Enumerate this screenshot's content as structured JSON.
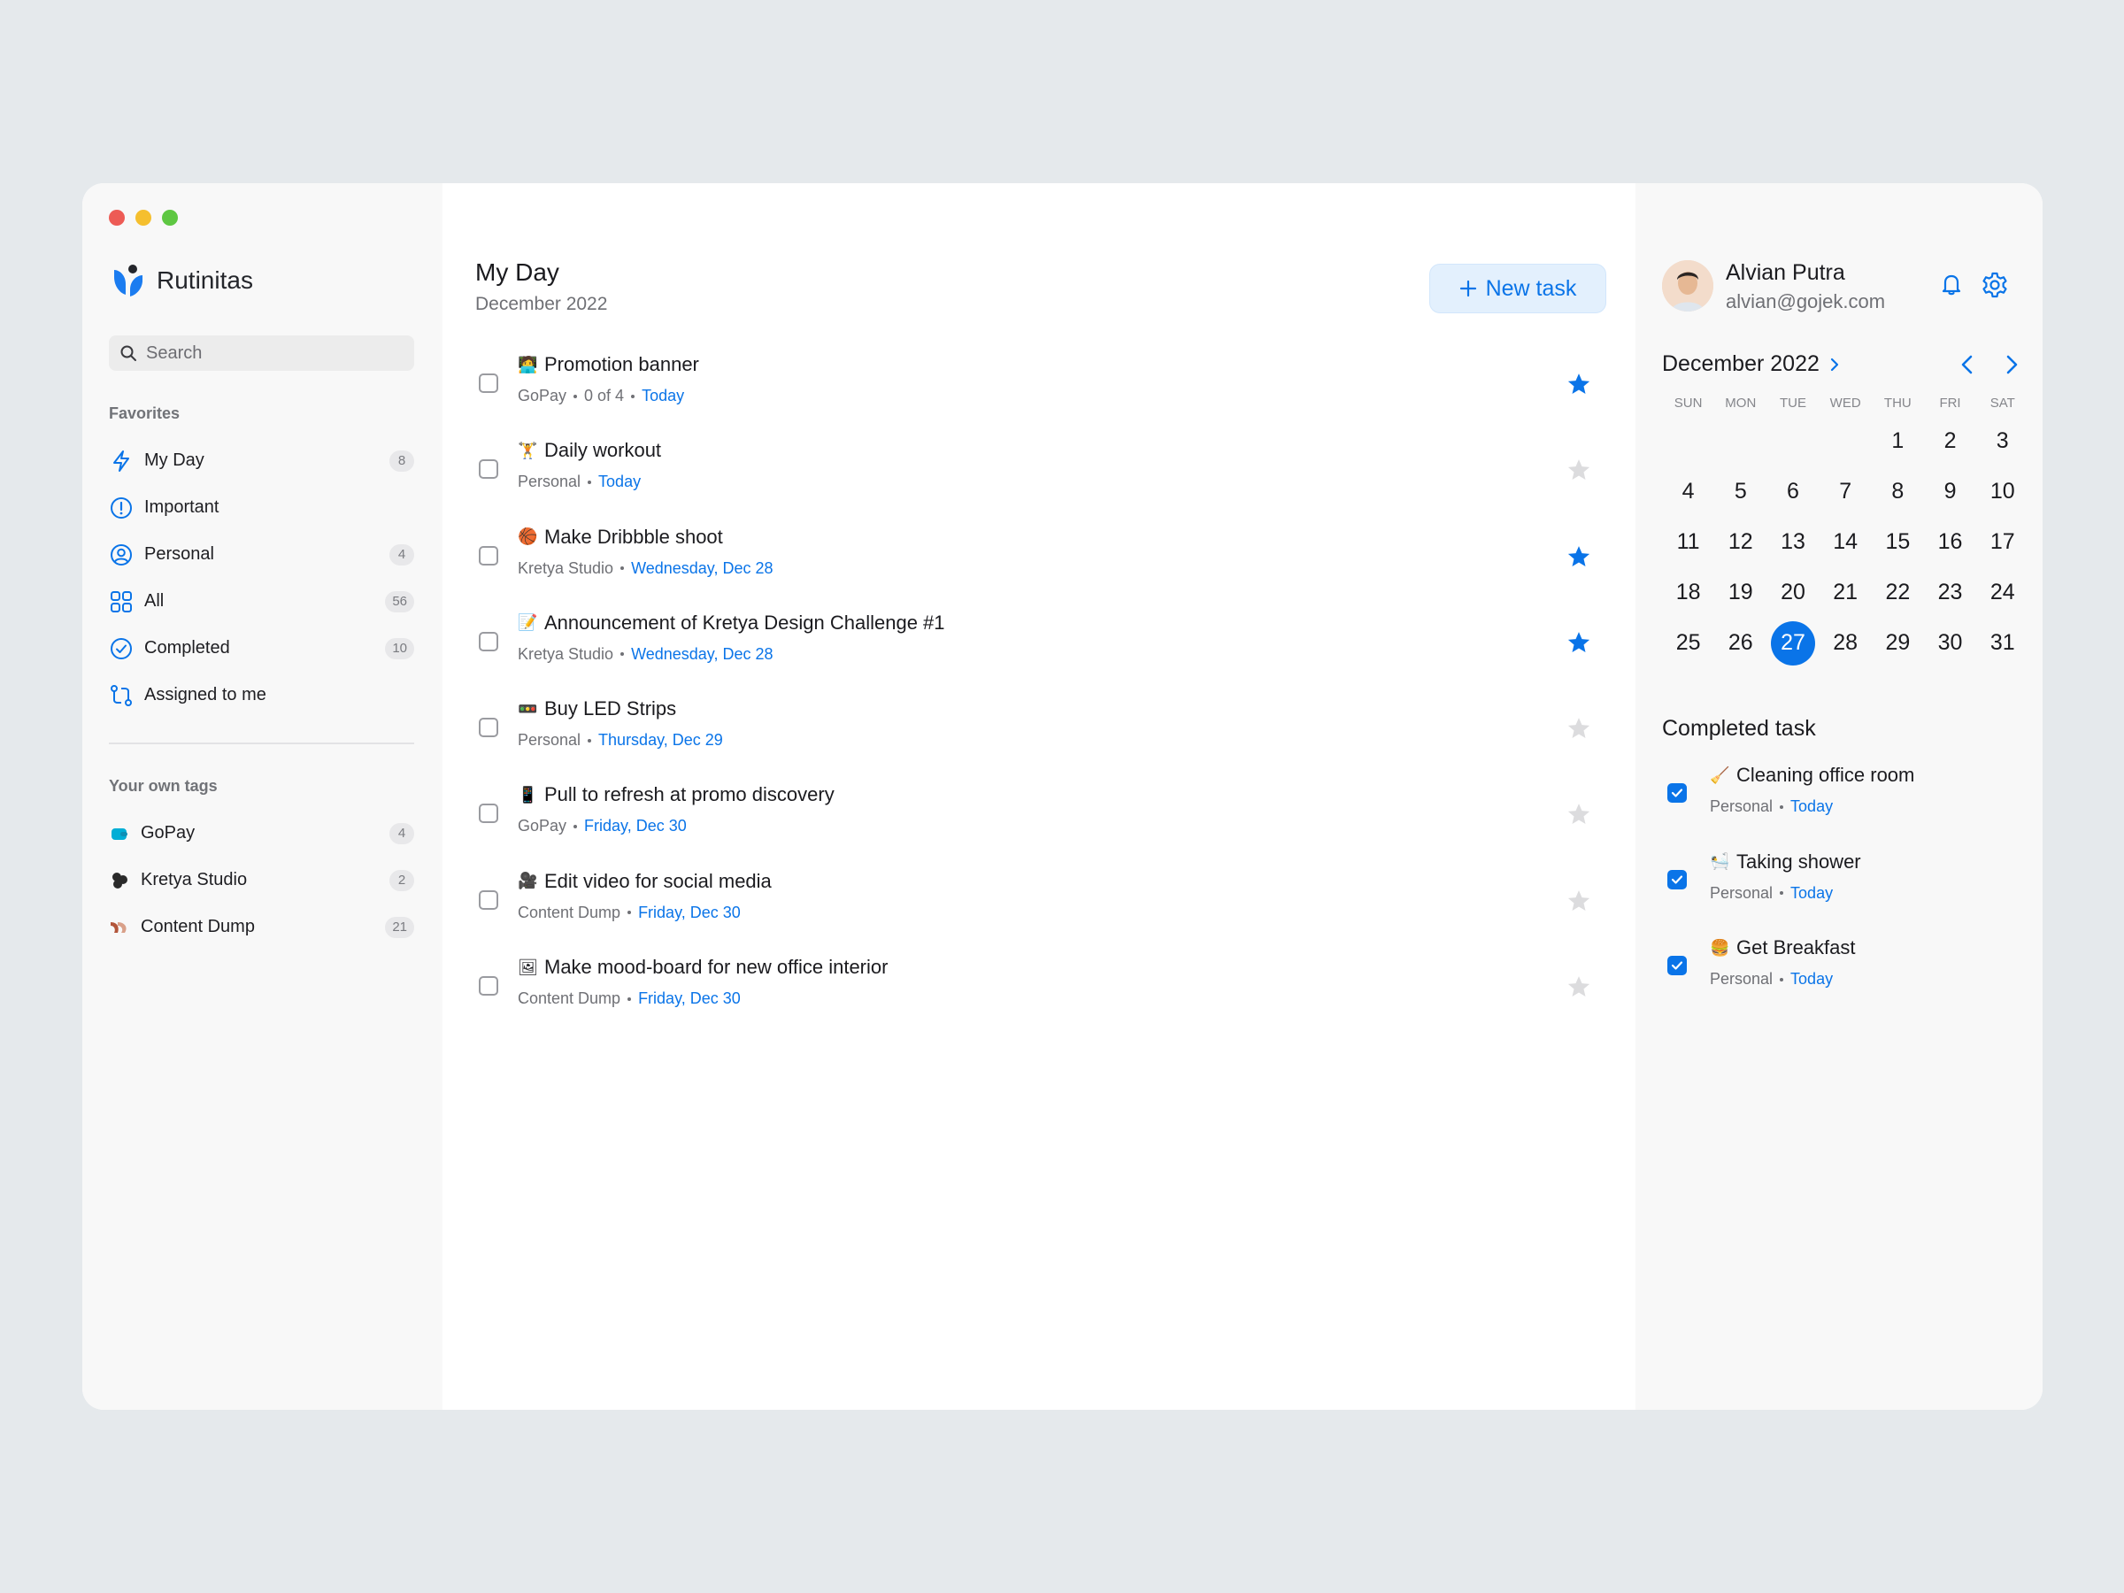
{
  "app": {
    "name": "Rutinitas"
  },
  "sidebar": {
    "search_placeholder": "Search",
    "favorites_label": "Favorites",
    "favorites": [
      {
        "label": "My Day",
        "count": "8",
        "icon": "bolt-icon"
      },
      {
        "label": "Important",
        "count": "",
        "icon": "exclamation-circle-icon"
      },
      {
        "label": "Personal",
        "count": "4",
        "icon": "user-circle-icon"
      },
      {
        "label": "All",
        "count": "56",
        "icon": "grid-icon"
      },
      {
        "label": "Completed",
        "count": "10",
        "icon": "check-circle-icon"
      },
      {
        "label": "Assigned to me",
        "count": "",
        "icon": "assign-icon"
      }
    ],
    "tags_label": "Your own tags",
    "tags": [
      {
        "label": "GoPay",
        "count": "4",
        "icon": "gopay-icon",
        "color": "#00aed6"
      },
      {
        "label": "Kretya Studio",
        "count": "2",
        "icon": "kretya-icon",
        "color": "#2a2a2a"
      },
      {
        "label": "Content Dump",
        "count": "21",
        "icon": "content-dump-icon",
        "color": "#b2553a"
      }
    ]
  },
  "main": {
    "title": "My Day",
    "subtitle": "December 2022",
    "new_task_label": "New task",
    "tasks": [
      {
        "emoji": "🧑‍💻",
        "title": "Promotion banner",
        "tag": "GoPay",
        "progress": "0 of 4",
        "due": "Today",
        "starred": true
      },
      {
        "emoji": "🏋",
        "title": "Daily workout",
        "tag": "Personal",
        "progress": "",
        "due": "Today",
        "starred": false
      },
      {
        "emoji": "🏀",
        "title": "Make Dribbble shoot",
        "tag": "Kretya Studio",
        "progress": "",
        "due": "Wednesday, Dec 28",
        "starred": true
      },
      {
        "emoji": "📝",
        "title": "Announcement of Kretya Design Challenge #1",
        "tag": "Kretya Studio",
        "progress": "",
        "due": "Wednesday, Dec 28",
        "starred": true
      },
      {
        "emoji": "🚥",
        "title": "Buy LED Strips",
        "tag": "Personal",
        "progress": "",
        "due": "Thursday, Dec 29",
        "starred": false
      },
      {
        "emoji": "📱",
        "title": "Pull to refresh at promo discovery",
        "tag": "GoPay",
        "progress": "",
        "due": "Friday, Dec 30",
        "starred": false
      },
      {
        "emoji": "🎥",
        "title": "Edit video for social media",
        "tag": "Content Dump",
        "progress": "",
        "due": "Friday, Dec 30",
        "starred": false
      },
      {
        "emoji": "🖼",
        "title": "Make mood-board for new office interior",
        "tag": "Content Dump",
        "progress": "",
        "due": "Friday, Dec 30",
        "starred": false
      }
    ]
  },
  "profile": {
    "name": "Alvian Putra",
    "email": "alvian@gojek.com"
  },
  "calendar": {
    "month_label": "December 2022",
    "weekdays": [
      "SUN",
      "MON",
      "TUE",
      "WED",
      "THU",
      "FRI",
      "SAT"
    ],
    "weeks": [
      [
        "",
        "",
        "",
        "",
        "1",
        "2",
        "3"
      ],
      [
        "4",
        "5",
        "6",
        "7",
        "8",
        "9",
        "10"
      ],
      [
        "11",
        "12",
        "13",
        "14",
        "15",
        "16",
        "17"
      ],
      [
        "18",
        "19",
        "20",
        "21",
        "22",
        "23",
        "24"
      ],
      [
        "25",
        "26",
        "27",
        "28",
        "29",
        "30",
        "31"
      ]
    ],
    "selected_day": "27"
  },
  "completed": {
    "title": "Completed task",
    "tasks": [
      {
        "emoji": "🧹",
        "title": "Cleaning office room",
        "tag": "Personal",
        "due": "Today"
      },
      {
        "emoji": "🛀",
        "title": "Taking shower",
        "tag": "Personal",
        "due": "Today"
      },
      {
        "emoji": "🍔",
        "title": "Get Breakfast",
        "tag": "Personal",
        "due": "Today"
      }
    ]
  },
  "colors": {
    "accent": "#0a74e8",
    "star_inactive": "#dcdcde",
    "sidebar_bg": "#f8f8f8",
    "page_bg": "#e5e9ec"
  }
}
